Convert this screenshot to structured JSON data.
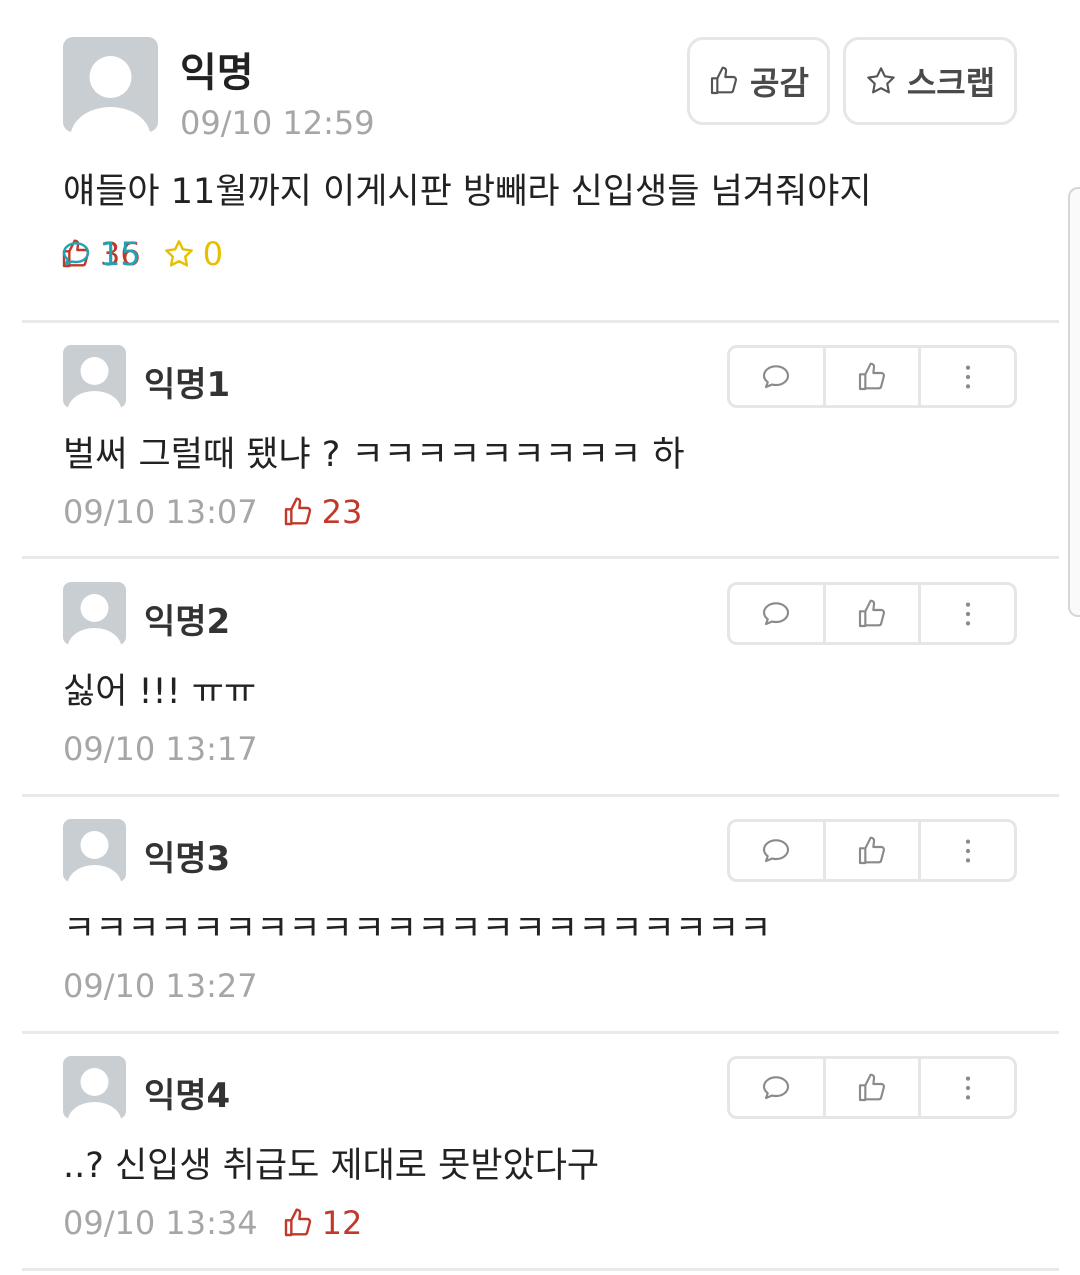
{
  "post": {
    "author": "익명",
    "time": "09/10 12:59",
    "like_button": "공감",
    "scrap_button": "스크랩",
    "body": "얘들아 11월까지 이게시판 방빼라 신입생들 넘겨줘야지",
    "stats": {
      "votes": "36",
      "comments": "15",
      "scraps": "0"
    }
  },
  "comments": [
    {
      "author": "익명1",
      "text": "벌써 그럴때 됐냐 ? ㅋㅋㅋㅋㅋㅋㅋㅋㅋ 하",
      "time": "09/10 13:07",
      "votes": "23"
    },
    {
      "author": "익명2",
      "text": "싫어 !!! ㅠㅠ",
      "time": "09/10 13:17",
      "votes": null
    },
    {
      "author": "익명3",
      "text": "ㅋㅋㅋㅋㅋㅋㅋㅋㅋㅋㅋㅋㅋㅋㅋㅋㅋㅋㅋㅋㅋㅋ",
      "time": "09/10 13:27",
      "votes": null
    },
    {
      "author": "익명4",
      "text": "..? 신입생 취급도 제대로 못받았다구",
      "time": "09/10 13:34",
      "votes": "12"
    }
  ],
  "icons": {
    "vote": "thumbs-up-icon",
    "comment": "speech-bubble-icon",
    "scrap": "star-icon",
    "more": "more-vertical-icon",
    "avatar": "default-avatar-icon"
  },
  "colors": {
    "vote": "#c0392b",
    "comment": "#1fa3b5",
    "scrap": "#e6c000",
    "meta": "#a6a6a6"
  }
}
